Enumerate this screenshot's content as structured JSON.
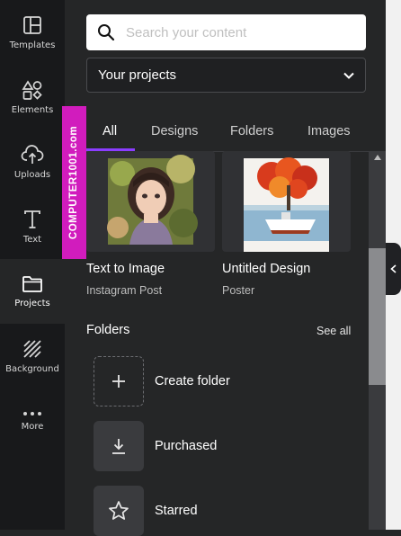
{
  "sidebar": {
    "items": [
      {
        "label": "Templates",
        "icon": "templates-icon"
      },
      {
        "label": "Elements",
        "icon": "elements-icon"
      },
      {
        "label": "Uploads",
        "icon": "upload-cloud-icon"
      },
      {
        "label": "Text",
        "icon": "text-icon"
      },
      {
        "label": "Projects",
        "icon": "folder-icon",
        "active": true
      },
      {
        "label": "Background",
        "icon": "background-stripes-icon"
      },
      {
        "label": "More",
        "icon": "more-dots-icon"
      }
    ]
  },
  "search": {
    "placeholder": "Search your content"
  },
  "filter": {
    "selected": "Your projects"
  },
  "tabs": [
    {
      "label": "All",
      "active": true
    },
    {
      "label": "Designs"
    },
    {
      "label": "Folders"
    },
    {
      "label": "Images"
    }
  ],
  "designs": [
    {
      "title": "Text to Image",
      "subtitle": "Instagram Post",
      "thumb": "anime-girl-portrait"
    },
    {
      "title": "Untitled Design",
      "subtitle": "Poster",
      "thumb": "red-tree-and-boat"
    }
  ],
  "folders_section": {
    "heading": "Folders",
    "see_all": "See all"
  },
  "folders": [
    {
      "label": "Create folder",
      "icon": "plus-icon"
    },
    {
      "label": "Purchased",
      "icon": "download-icon"
    },
    {
      "label": "Starred",
      "icon": "star-icon"
    }
  ],
  "watermark": "COMPUTER1001.com",
  "colors": {
    "accent": "#8b3dff",
    "rail_bg": "#18191b",
    "panel_bg": "#252627",
    "watermark_bg": "#d11cbd"
  }
}
